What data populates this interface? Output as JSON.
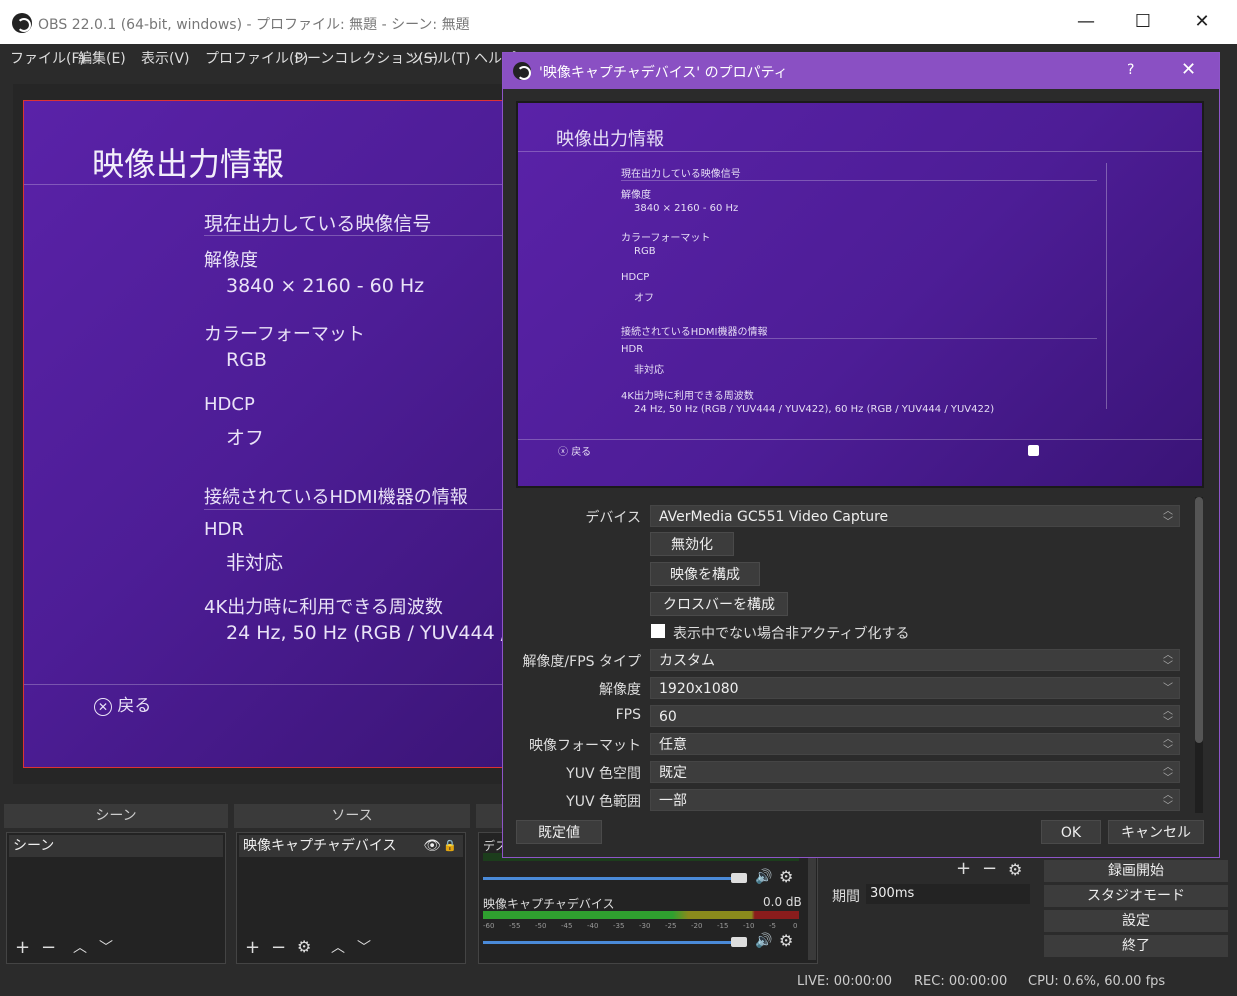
{
  "window": {
    "title": "OBS 22.0.1 (64-bit, windows) - プロファイル: 無題 - シーン: 無題"
  },
  "menu": [
    "ファイル(F)",
    "編集(E)",
    "表示(V)",
    "プロファイル(P)",
    "シーンコレクション(S)",
    "ツール(T)",
    "ヘルプ(H)"
  ],
  "preview": {
    "heading": "映像出力情報",
    "section1": "現在出力している映像信号",
    "resolution_label": "解像度",
    "resolution_value": "3840 × 2160 - 60 Hz",
    "color_label": "カラーフォーマット",
    "color_value": "RGB",
    "hdcp_label": "HDCP",
    "hdcp_value": "オフ",
    "section2": "接続されているHDMI機器の情報",
    "hdr_label": "HDR",
    "hdr_value": "非対応",
    "freq_label": "4K出力時に利用できる周波数",
    "freq_value": "24 Hz, 50 Hz (RGB / YUV444 /",
    "back": "戻る"
  },
  "docks": {
    "scenes": "シーン",
    "sources": "ソース",
    "scene_item": "シーン",
    "source_item": "映像キャプチャデバイス"
  },
  "mixer": {
    "ch1": "デス",
    "ch2": "映像キャプチャデバイス",
    "db2": "0.0 dB",
    "ticks": [
      "-60",
      "-55",
      "-50",
      "-45",
      "-40",
      "-35",
      "-30",
      "-25",
      "-20",
      "-15",
      "-10",
      "-5",
      "0"
    ]
  },
  "transition": {
    "duration_label": "期間",
    "duration_value": "300ms"
  },
  "controls": [
    "録画開始",
    "スタジオモード",
    "設定",
    "終了"
  ],
  "status": {
    "live": "LIVE: 00:00:00",
    "rec": "REC: 00:00:00",
    "cpu": "CPU: 0.6%, 60.00 fps"
  },
  "dialog": {
    "title": "'映像キャプチャデバイス' のプロパティ",
    "help": "?",
    "preview": {
      "heading": "映像出力情報",
      "section1": "現在出力している映像信号",
      "res_label": "解像度",
      "res_value": "3840 × 2160 - 60 Hz",
      "color_label": "カラーフォーマット",
      "color_value": "RGB",
      "hdcp_label": "HDCP",
      "hdcp_value": "オフ",
      "section2": "接続されているHDMI機器の情報",
      "hdr_label": "HDR",
      "hdr_value": "非対応",
      "freq_label": "4K出力時に利用できる周波数",
      "freq_value": "24 Hz, 50 Hz (RGB / YUV444 / YUV422), 60 Hz (RGB / YUV444 / YUV422)",
      "back": "戻る"
    },
    "fields": {
      "device_label": "デバイス",
      "device_value": "AVerMedia GC551  Video Capture",
      "disable_btn": "無効化",
      "configure_video_btn": "映像を構成",
      "configure_crossbar_btn": "クロスバーを構成",
      "deactivate_label": "表示中でない場合非アクティブ化する",
      "res_type_label": "解像度/FPS タイプ",
      "res_type_value": "カスタム",
      "res_label": "解像度",
      "res_value": "1920x1080",
      "fps_label": "FPS",
      "fps_value": "60",
      "vformat_label": "映像フォーマット",
      "vformat_value": "任意",
      "yuv_space_label": "YUV 色空間",
      "yuv_space_value": "既定",
      "yuv_range_label": "YUV 色範囲",
      "yuv_range_value": "一部"
    },
    "buttons": {
      "defaults": "既定値",
      "ok": "OK",
      "cancel": "キャンセル"
    }
  }
}
